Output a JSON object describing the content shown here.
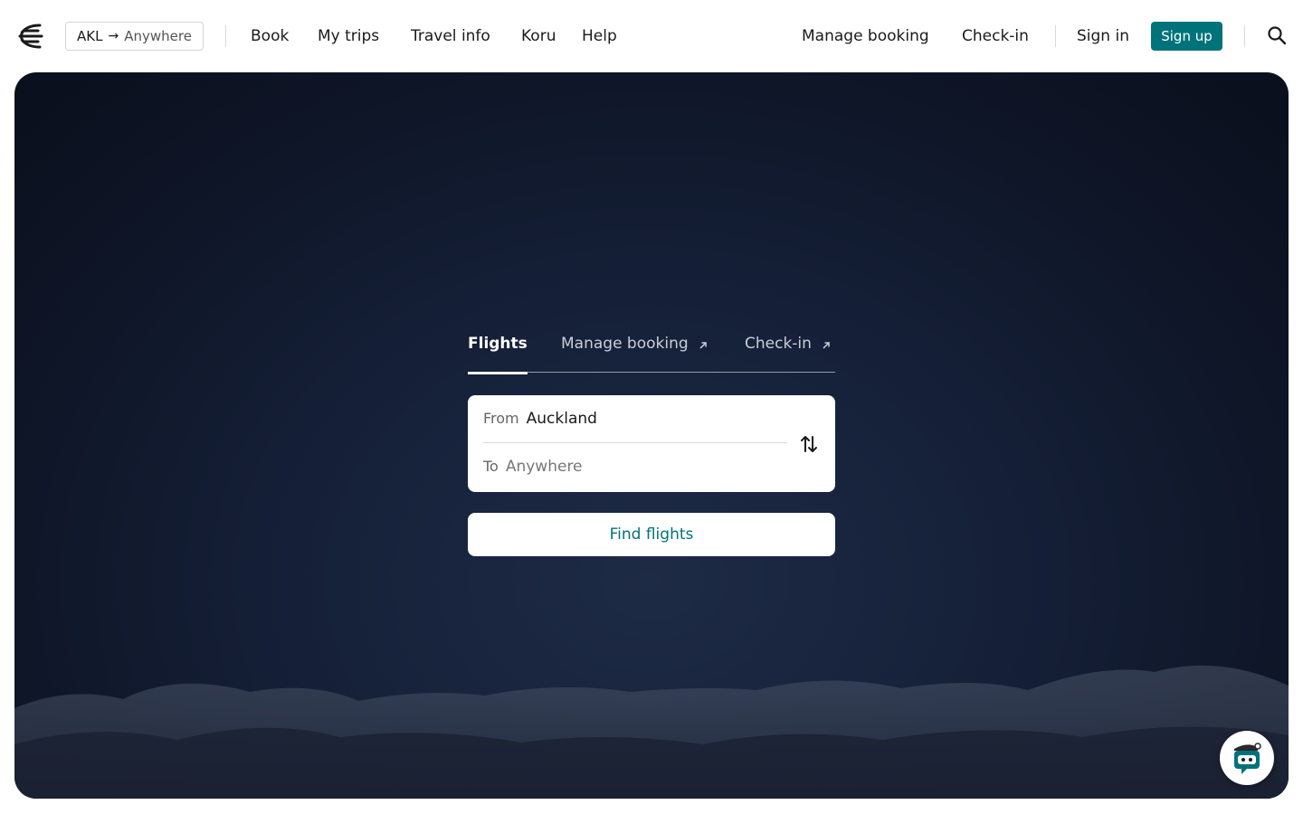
{
  "header": {
    "route": {
      "from": "AKL",
      "to": "Anywhere"
    },
    "nav": [
      "Book",
      "My trips",
      "Travel info",
      "Koru",
      "Help"
    ],
    "manage_booking": "Manage booking",
    "check_in": "Check-in",
    "sign_in": "Sign in",
    "sign_up": "Sign up"
  },
  "tabs": {
    "flights": "Flights",
    "manage_booking": "Manage booking",
    "check_in": "Check-in"
  },
  "search": {
    "from_label": "From",
    "from_value": "Auckland",
    "to_label": "To",
    "to_placeholder": "Anywhere",
    "find_button": "Find flights"
  },
  "colors": {
    "accent": "#00737a",
    "hero_dark": "#0f1628"
  }
}
